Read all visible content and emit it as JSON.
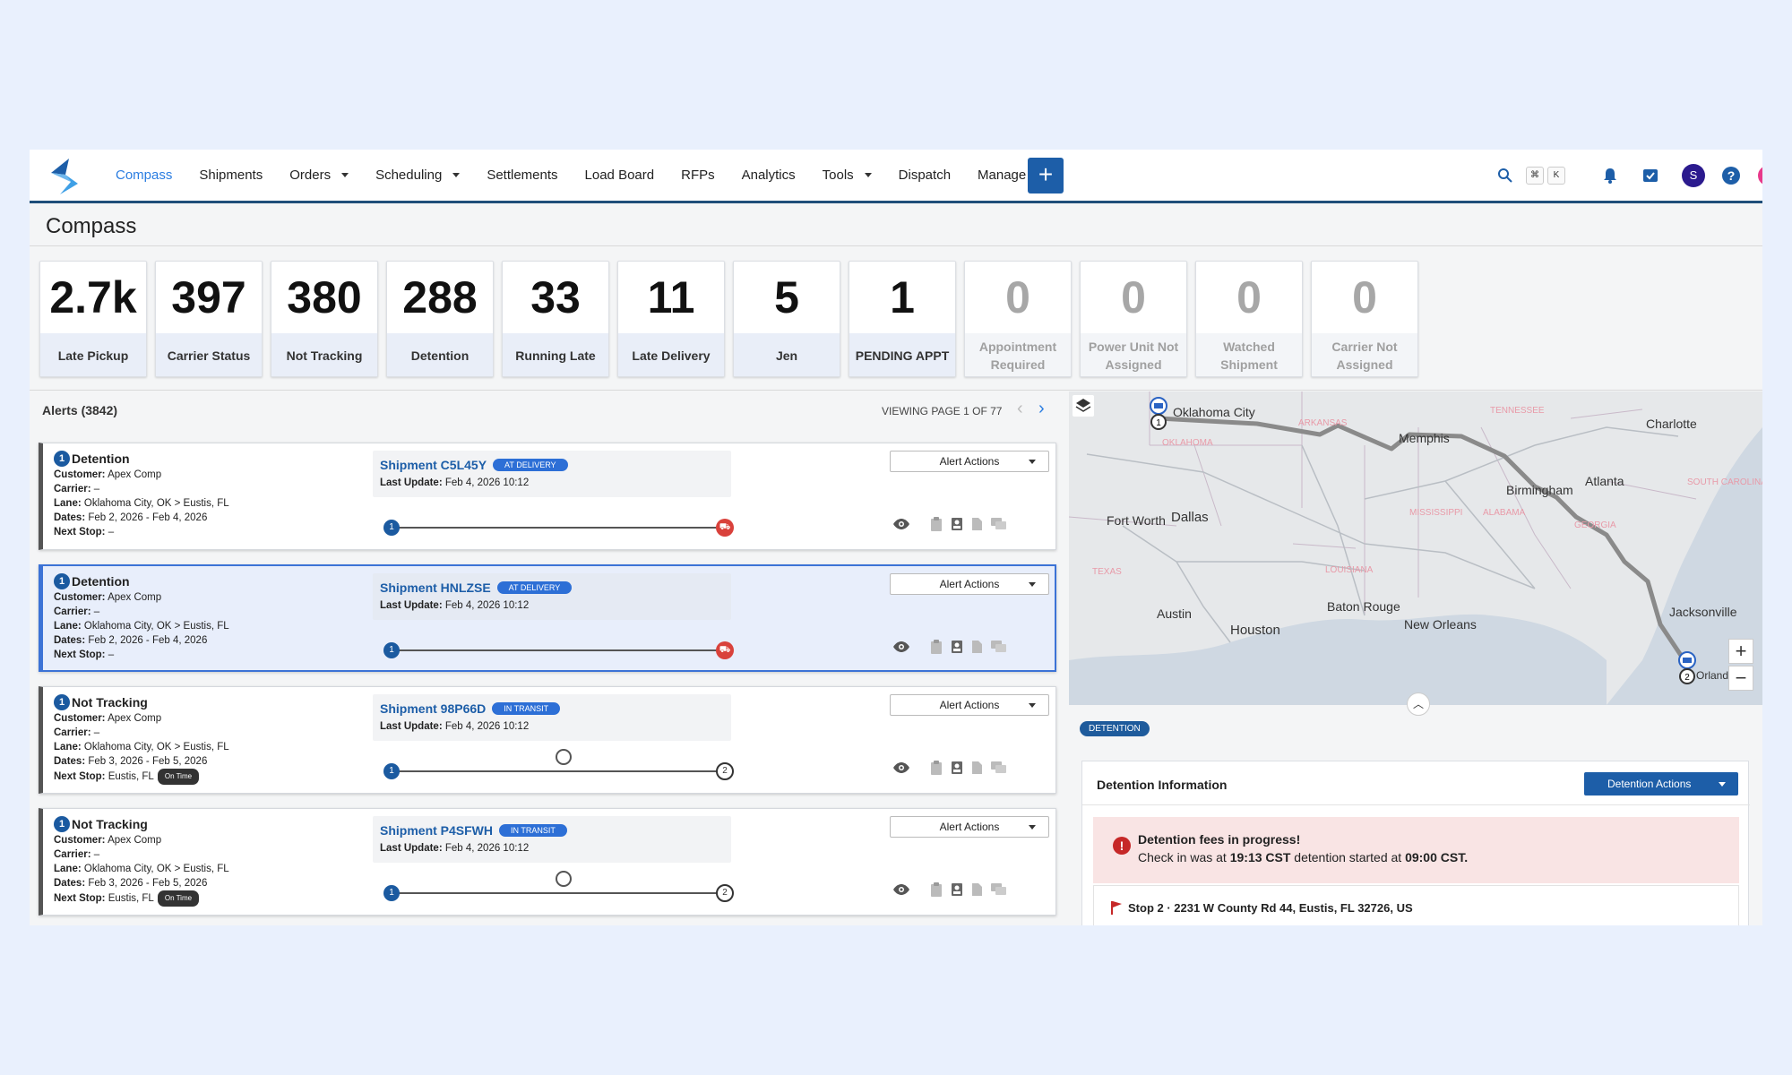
{
  "nav": {
    "items": [
      {
        "label": "Compass",
        "active": true,
        "dropdown": false
      },
      {
        "label": "Shipments",
        "dropdown": false
      },
      {
        "label": "Orders",
        "dropdown": true
      },
      {
        "label": "Scheduling",
        "dropdown": true
      },
      {
        "label": "Settlements",
        "dropdown": false
      },
      {
        "label": "Load Board",
        "dropdown": false
      },
      {
        "label": "RFPs",
        "dropdown": false
      },
      {
        "label": "Analytics",
        "dropdown": false
      },
      {
        "label": "Tools",
        "dropdown": true
      },
      {
        "label": "Dispatch",
        "dropdown": false
      },
      {
        "label": "Manage",
        "dropdown": true
      }
    ],
    "plus_label": "+",
    "kbd_cmd": "⌘",
    "kbd_k": "K",
    "avatar_letter": "S"
  },
  "page": {
    "title": "Compass"
  },
  "cards": [
    {
      "value": "2.7k",
      "label": "Late Pickup",
      "dim": false
    },
    {
      "value": "397",
      "label": "Carrier Status",
      "dim": false
    },
    {
      "value": "380",
      "label": "Not Tracking",
      "dim": false
    },
    {
      "value": "288",
      "label": "Detention",
      "dim": false
    },
    {
      "value": "33",
      "label": "Running Late",
      "dim": false
    },
    {
      "value": "11",
      "label": "Late Delivery",
      "dim": false
    },
    {
      "value": "5",
      "label": "Jen",
      "dim": false
    },
    {
      "value": "1",
      "label": "PENDING APPT",
      "dim": false
    },
    {
      "value": "0",
      "label": "Appointment Required",
      "dim": true
    },
    {
      "value": "0",
      "label": "Power Unit Not Assigned",
      "dim": true
    },
    {
      "value": "0",
      "label": "Watched Shipment",
      "dim": true
    },
    {
      "value": "0",
      "label": "Carrier Not Assigned",
      "dim": true
    }
  ],
  "alerts_header": "Alerts (3842)",
  "pager": {
    "text": "VIEWING PAGE 1 OF 77"
  },
  "alert_labels": {
    "customer": "Customer:",
    "carrier": "Carrier:",
    "lane": "Lane:",
    "dates": "Dates:",
    "next_stop": "Next Stop:",
    "last_update": "Last Update:",
    "actions": "Alert Actions"
  },
  "alerts": [
    {
      "num": "1",
      "type": "Detention",
      "customer": "Apex Comp",
      "carrier": "–",
      "lane": "Oklahoma City, OK > Eustis, FL",
      "dates": "Feb 2, 2026 - Feb 4, 2026",
      "next_stop": "–",
      "ontime": "",
      "shipment": "Shipment C5L45Y",
      "status": "AT DELIVERY",
      "last_update": "Feb 4, 2026 10:12",
      "selected": false,
      "progress": 1.0
    },
    {
      "num": "1",
      "type": "Detention",
      "customer": "Apex Comp",
      "carrier": "–",
      "lane": "Oklahoma City, OK > Eustis, FL",
      "dates": "Feb 2, 2026 - Feb 4, 2026",
      "next_stop": "–",
      "ontime": "",
      "shipment": "Shipment HNLZSE",
      "status": "AT DELIVERY",
      "last_update": "Feb 4, 2026 10:12",
      "selected": true,
      "progress": 1.0
    },
    {
      "num": "1",
      "type": "Not Tracking",
      "customer": "Apex Comp",
      "carrier": "–",
      "lane": "Oklahoma City, OK > Eustis, FL",
      "dates": "Feb 3, 2026 - Feb 5, 2026",
      "next_stop": "Eustis, FL",
      "ontime": "On Time",
      "shipment": "Shipment 98P66D",
      "status": "IN TRANSIT",
      "last_update": "Feb 4, 2026 10:12",
      "selected": false,
      "progress": 0.5
    },
    {
      "num": "1",
      "type": "Not Tracking",
      "customer": "Apex Comp",
      "carrier": "–",
      "lane": "Oklahoma City, OK > Eustis, FL",
      "dates": "Feb 3, 2026 - Feb 5, 2026",
      "next_stop": "Eustis, FL",
      "ontime": "On Time",
      "shipment": "Shipment P4SFWH",
      "status": "IN TRANSIT",
      "last_update": "Feb 4, 2026 10:12",
      "selected": false,
      "progress": 0.5
    }
  ],
  "map": {
    "labels": [
      "Oklahoma City",
      "Memphis",
      "Charlotte",
      "Atlanta",
      "Birmingham",
      "Fort Worth",
      "Dallas",
      "Austin",
      "Houston",
      "Baton Rouge",
      "New Orleans",
      "Jacksonville",
      "Orlando",
      "ARKANSAS",
      "TENNESSEE",
      "OKLAHOMA",
      "MISSISSIPPI",
      "ALABAMA",
      "GEORGIA",
      "SOUTH CAROLINA",
      "TEXAS",
      "LOUISIANA"
    ],
    "zoom_in": "+",
    "zoom_out": "−"
  },
  "detention": {
    "badge": "DETENTION",
    "title": "Detention Information",
    "actions": "Detention Actions",
    "alert_title": "Detention fees in progress!",
    "alert_prefix": "Check in was at ",
    "check_in": "19:13 CST",
    "alert_mid": " detention started at ",
    "started": "09:00 CST.",
    "stop": "Stop 2 · 2231 W County Rd 44, Eustis, FL 32726, US"
  },
  "colors": {
    "accent": "#1d5ea8",
    "active_nav": "#2a7de1",
    "danger": "#d9413b",
    "status_pill": "#2d6fd6"
  }
}
